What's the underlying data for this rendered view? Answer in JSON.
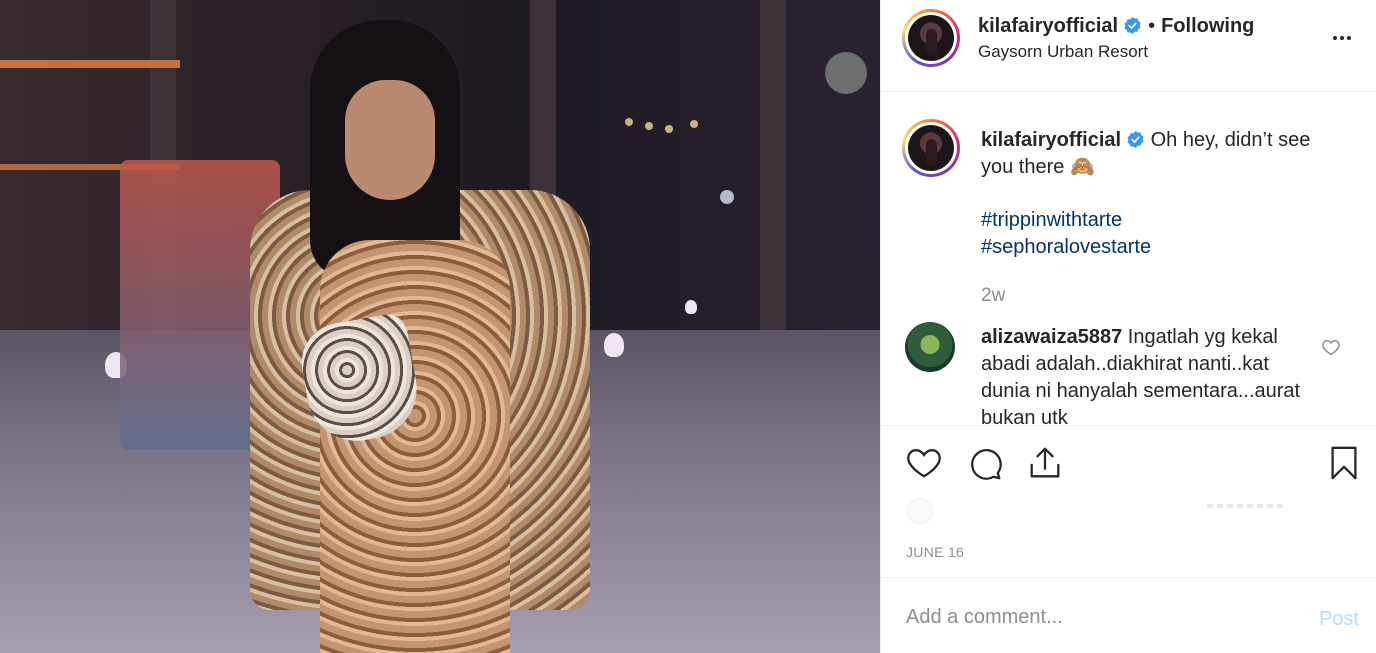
{
  "post": {
    "username": "kilafairyofficial",
    "separator": "•",
    "follow_status": "Following",
    "location": "Gaysorn Urban Resort",
    "image_alt": "Woman in snakeskin print outfit standing at night venue"
  },
  "caption": {
    "username": "kilafairyofficial",
    "text": "Oh hey, didn’t see you there 🙈",
    "hashtags": [
      "#trippinwithtarte",
      "#sephoralovestarte"
    ],
    "age": "2w"
  },
  "comments": [
    {
      "username": "alizawaiza5887",
      "text": "Ingatlah yg kekal abadi adalah..diakhirat nanti..kat dunia ni hanyalah sementara...aurat bukan utk"
    }
  ],
  "actions": {
    "date": "JUNE 16",
    "icons": [
      "heart-icon",
      "comment-icon",
      "share-icon",
      "bookmark-icon"
    ]
  },
  "add_comment": {
    "placeholder": "Add a comment...",
    "post_label": "Post"
  },
  "colors": {
    "verified": "#3897f0",
    "hashtag": "#003569",
    "muted": "#8e8e8e",
    "post_button": "#b2dffc"
  }
}
